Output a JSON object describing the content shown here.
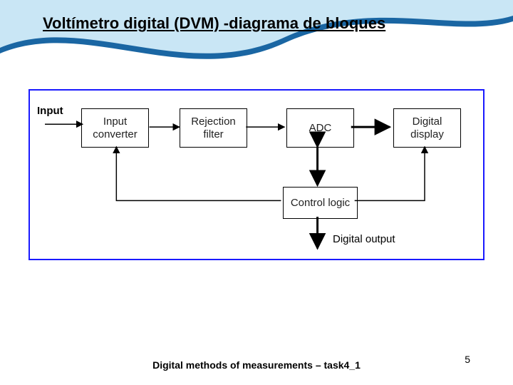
{
  "title": "Voltímetro digital (DVM) -diagrama de bloques",
  "labels": {
    "input": "Input",
    "digital_output": "Digital output"
  },
  "blocks": {
    "input_converter": "Input converter",
    "rejection_filter": "Rejection filter",
    "adc": "ADC",
    "digital_display": "Digital display",
    "control_logic": "Control logic"
  },
  "footer": "Digital methods of measurements – task4_1",
  "page_number": "5"
}
